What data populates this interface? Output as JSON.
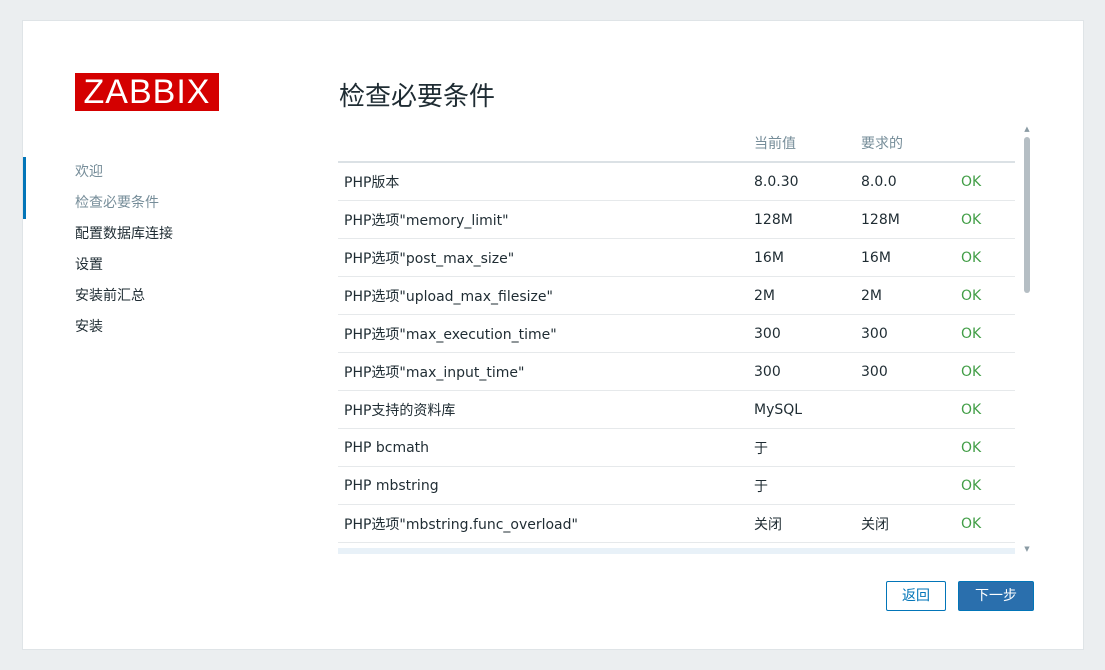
{
  "logo": {
    "text": "ZABBIX",
    "color": "#d40000"
  },
  "sidebar": {
    "steps": [
      {
        "label": "欢迎",
        "state": "done"
      },
      {
        "label": "检查必要条件",
        "state": "current"
      },
      {
        "label": "配置数据库连接",
        "state": "todo"
      },
      {
        "label": "设置",
        "state": "todo"
      },
      {
        "label": "安装前汇总",
        "state": "todo"
      },
      {
        "label": "安装",
        "state": "todo"
      }
    ]
  },
  "main": {
    "title": "检查必要条件",
    "table": {
      "headers": [
        "",
        "当前值",
        "要求的",
        ""
      ],
      "rows": [
        {
          "name": "PHP版本",
          "current": "8.0.30",
          "required": "8.0.0",
          "status": "OK"
        },
        {
          "name": "PHP选项\"memory_limit\"",
          "current": "128M",
          "required": "128M",
          "status": "OK"
        },
        {
          "name": "PHP选项\"post_max_size\"",
          "current": "16M",
          "required": "16M",
          "status": "OK"
        },
        {
          "name": "PHP选项\"upload_max_filesize\"",
          "current": "2M",
          "required": "2M",
          "status": "OK"
        },
        {
          "name": "PHP选项\"max_execution_time\"",
          "current": "300",
          "required": "300",
          "status": "OK"
        },
        {
          "name": "PHP选项\"max_input_time\"",
          "current": "300",
          "required": "300",
          "status": "OK"
        },
        {
          "name": "PHP支持的资料库",
          "current": "MySQL",
          "required": "",
          "status": "OK"
        },
        {
          "name": "PHP bcmath",
          "current": "于",
          "required": "",
          "status": "OK"
        },
        {
          "name": "PHP mbstring",
          "current": "于",
          "required": "",
          "status": "OK"
        },
        {
          "name": "PHP选项\"mbstring.func_overload\"",
          "current": "关闭",
          "required": "关闭",
          "status": "OK"
        }
      ]
    }
  },
  "buttons": {
    "back": "返回",
    "next": "下一步"
  },
  "colors": {
    "ok": "#429e47",
    "accent": "#0275b8",
    "primary_button": "#2a6fad"
  }
}
